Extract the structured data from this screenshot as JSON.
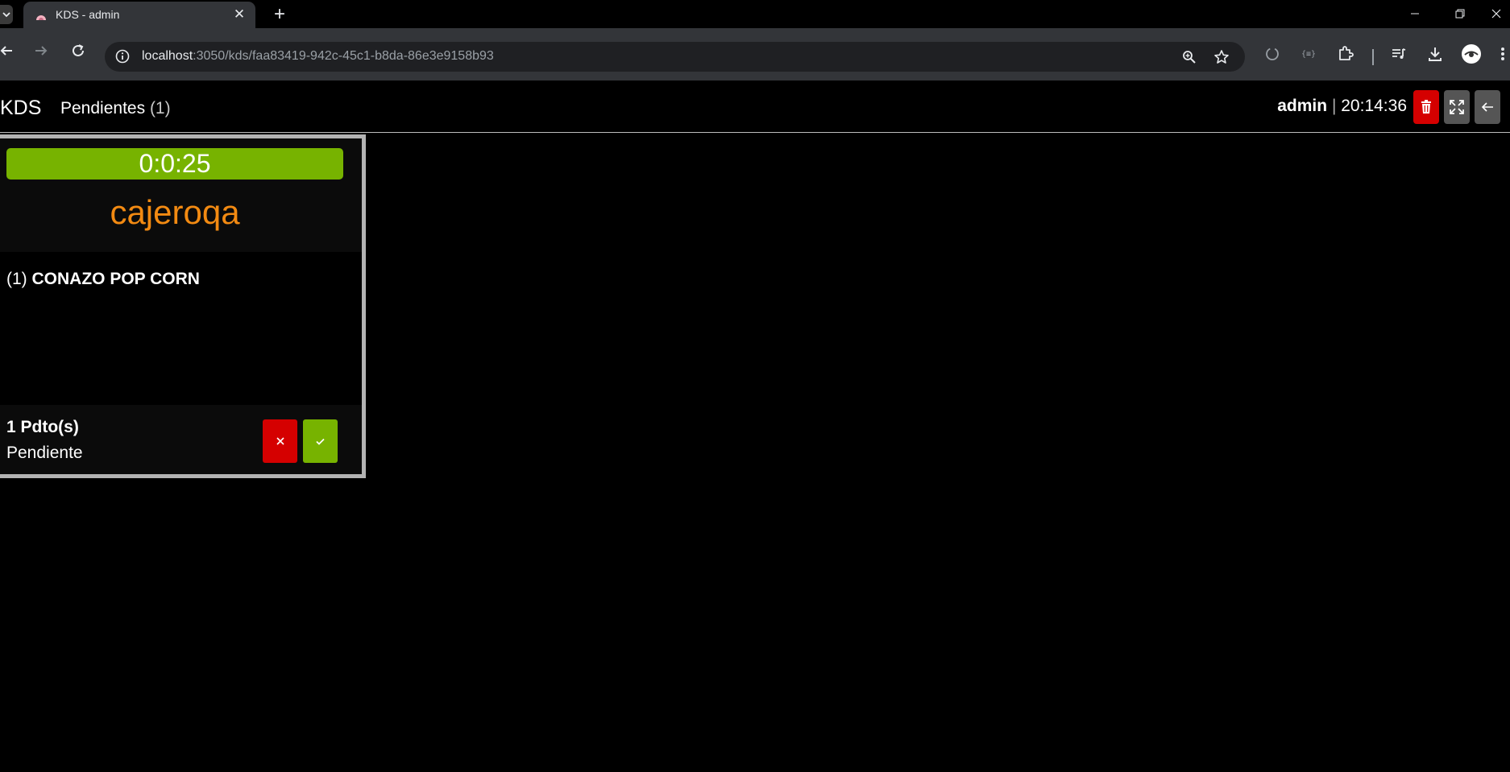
{
  "browser": {
    "tab_title": "KDS - admin",
    "url_host": "localhost",
    "url_path": ":3050/kds/faa83419-942c-45c1-b8da-86e3e9158b93"
  },
  "header": {
    "brand": "KDS",
    "nav_label": "Pendientes",
    "nav_count": "(1)",
    "user": "admin",
    "separator": "|",
    "clock": "20:14:36"
  },
  "order": {
    "timer": "0:0:25",
    "cashier": "cajeroqa",
    "items": [
      {
        "qty": "(1)",
        "name": "CONAZO POP CORN"
      }
    ],
    "product_count": "1 Pdto(s)",
    "status": "Pendiente"
  },
  "colors": {
    "accent_green": "#77b300",
    "danger_red": "#d50000",
    "cashier_orange": "#f28a12"
  },
  "icons": {
    "delete": "trash-icon",
    "fullscreen": "fullscreen-icon",
    "back": "arrow-left-icon",
    "cancel": "close-icon",
    "confirm": "check-icon"
  }
}
